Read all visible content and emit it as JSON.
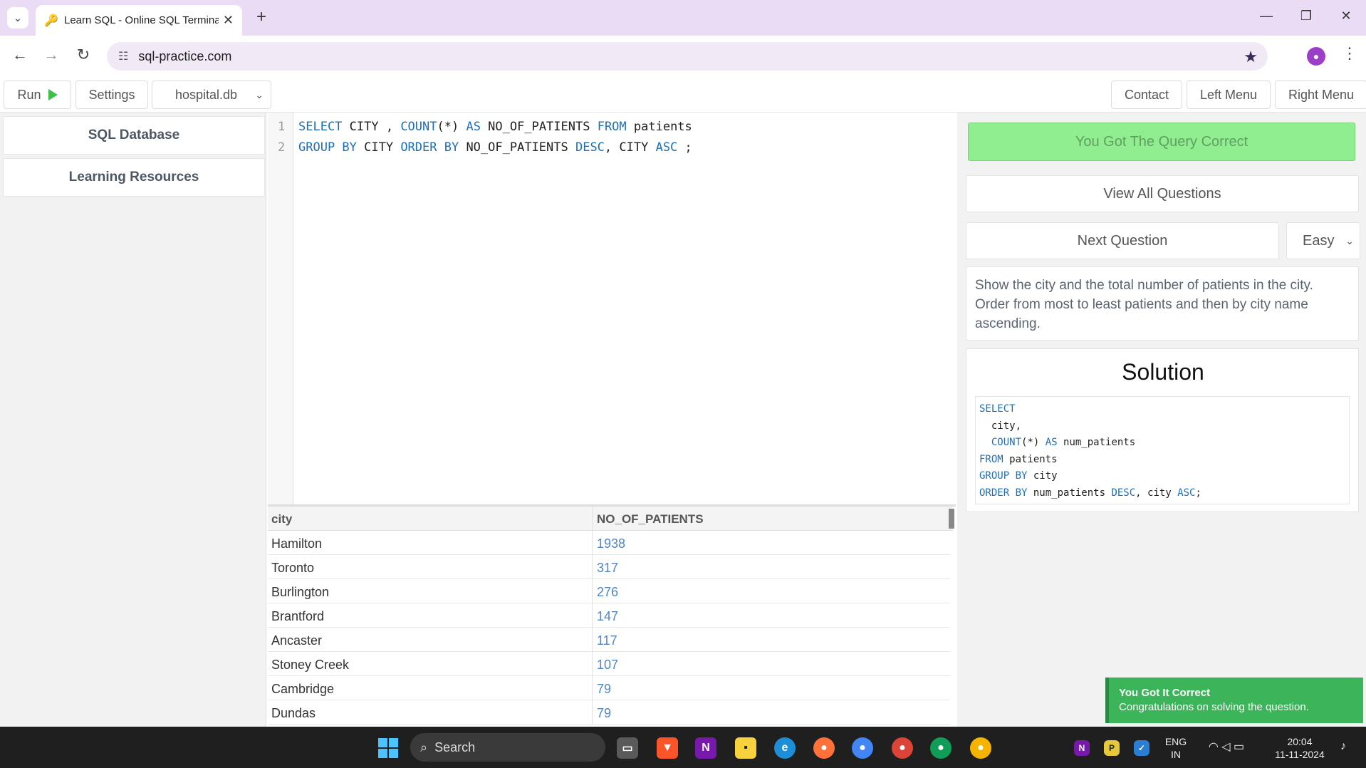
{
  "browser": {
    "tab_title": "Learn SQL - Online SQL Terminal",
    "url": "sql-practice.com",
    "new_tab_symbol": "+"
  },
  "toolbar": {
    "run_label": "Run",
    "settings_label": "Settings",
    "database_selected": "hospital.db",
    "contact_label": "Contact",
    "left_menu_label": "Left Menu",
    "right_menu_label": "Right Menu"
  },
  "sidebar": {
    "items": [
      {
        "label": "SQL Database"
      },
      {
        "label": "Learning Resources"
      }
    ]
  },
  "editor": {
    "line_numbers": [
      "1",
      "2"
    ],
    "line1": [
      {
        "text": "SELECT",
        "kw": true
      },
      {
        "text": " CITY , ",
        "kw": false
      },
      {
        "text": "COUNT",
        "kw": true
      },
      {
        "text": "(*) ",
        "kw": false
      },
      {
        "text": "AS",
        "kw": true
      },
      {
        "text": " NO_OF_PATIENTS ",
        "kw": false
      },
      {
        "text": "FROM",
        "kw": true
      },
      {
        "text": " patients",
        "kw": false
      }
    ],
    "line2": [
      {
        "text": "GROUP BY",
        "kw": true
      },
      {
        "text": " CITY ",
        "kw": false
      },
      {
        "text": "ORDER BY",
        "kw": true
      },
      {
        "text": " NO_OF_PATIENTS ",
        "kw": false
      },
      {
        "text": "DESC",
        "kw": true
      },
      {
        "text": ", CITY ",
        "kw": false
      },
      {
        "text": "ASC",
        "kw": true
      },
      {
        "text": " ;",
        "kw": false
      }
    ]
  },
  "results": {
    "columns": [
      "city",
      "NO_OF_PATIENTS"
    ],
    "rows": [
      [
        "Hamilton",
        "1938"
      ],
      [
        "Toronto",
        "317"
      ],
      [
        "Burlington",
        "276"
      ],
      [
        "Brantford",
        "147"
      ],
      [
        "Ancaster",
        "117"
      ],
      [
        "Stoney Creek",
        "107"
      ],
      [
        "Cambridge",
        "79"
      ],
      [
        "Dundas",
        "79"
      ]
    ]
  },
  "right_panel": {
    "status": "You Got The Query Correct",
    "view_all_label": "View All Questions",
    "next_question_label": "Next Question",
    "difficulty_selected": "Easy",
    "question_text": "Show the city and the total number of patients in the city. Order from most to least patients and then by city name ascending.",
    "solution_title": "Solution",
    "solution_lines": [
      [
        {
          "text": "SELECT",
          "kw": true
        }
      ],
      [
        {
          "text": "  city,",
          "kw": false
        }
      ],
      [
        {
          "text": "  ",
          "kw": false
        },
        {
          "text": "COUNT",
          "kw": true
        },
        {
          "text": "(*) ",
          "kw": false
        },
        {
          "text": "AS",
          "kw": true
        },
        {
          "text": " num_patients",
          "kw": false
        }
      ],
      [
        {
          "text": "FROM",
          "kw": true
        },
        {
          "text": " patients",
          "kw": false
        }
      ],
      [
        {
          "text": "GROUP BY",
          "kw": true
        },
        {
          "text": " city",
          "kw": false
        }
      ],
      [
        {
          "text": "ORDER BY",
          "kw": true
        },
        {
          "text": " num_patients ",
          "kw": false
        },
        {
          "text": "DESC",
          "kw": true
        },
        {
          "text": ", city ",
          "kw": false
        },
        {
          "text": "ASC",
          "kw": true
        },
        {
          "text": ";",
          "kw": false
        }
      ]
    ]
  },
  "toast": {
    "title": "You Got It Correct",
    "message": "Congratulations on solving the question."
  },
  "taskbar": {
    "search_placeholder": "Search",
    "language": "ENG",
    "region": "IN",
    "time": "20:04",
    "date": "11-11-2024"
  },
  "colors": {
    "keyword": "#1f6fb7",
    "success": "#90ee90",
    "toast": "#3cb55a"
  }
}
